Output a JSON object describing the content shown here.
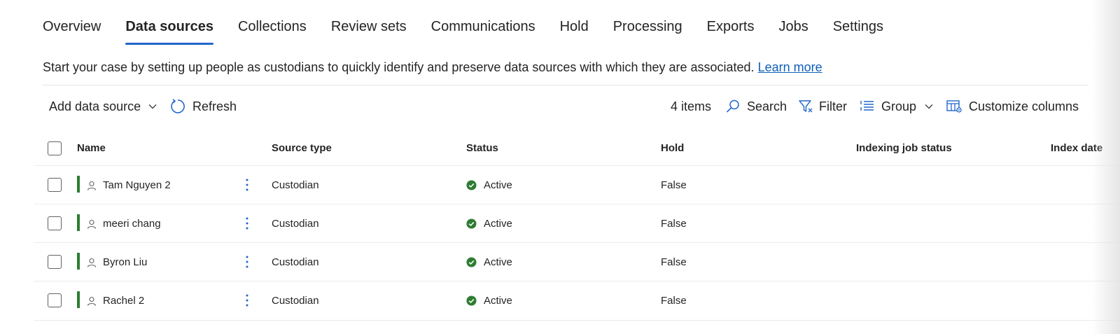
{
  "tabs": [
    {
      "label": "Overview"
    },
    {
      "label": "Data sources",
      "active": true
    },
    {
      "label": "Collections"
    },
    {
      "label": "Review sets"
    },
    {
      "label": "Communications"
    },
    {
      "label": "Hold"
    },
    {
      "label": "Processing"
    },
    {
      "label": "Exports"
    },
    {
      "label": "Jobs"
    },
    {
      "label": "Settings"
    }
  ],
  "intro": {
    "text": "Start your case by setting up people as custodians to quickly identify and preserve data sources with which they are associated.",
    "link": "Learn more"
  },
  "toolbar": {
    "add_data_source": "Add data source",
    "refresh": "Refresh",
    "item_count": "4 items",
    "search": "Search",
    "filter": "Filter",
    "group": "Group",
    "customize_columns": "Customize columns"
  },
  "table": {
    "columns": {
      "name": "Name",
      "source_type": "Source type",
      "status": "Status",
      "hold": "Hold",
      "indexing_job_status": "Indexing job status",
      "index_date": "Index date"
    },
    "rows": [
      {
        "name": "Tam Nguyen 2",
        "source_type": "Custodian",
        "status": "Active",
        "hold": "False"
      },
      {
        "name": "meeri chang",
        "source_type": "Custodian",
        "status": "Active",
        "hold": "False"
      },
      {
        "name": "Byron Liu",
        "source_type": "Custodian",
        "status": "Active",
        "hold": "False"
      },
      {
        "name": "Rachel 2",
        "source_type": "Custodian",
        "status": "Active",
        "hold": "False"
      }
    ]
  },
  "colors": {
    "accent": "#2266c9",
    "link": "#0f5fba",
    "status_active": "#2e7d32",
    "row_bar": "#2e7d32"
  }
}
